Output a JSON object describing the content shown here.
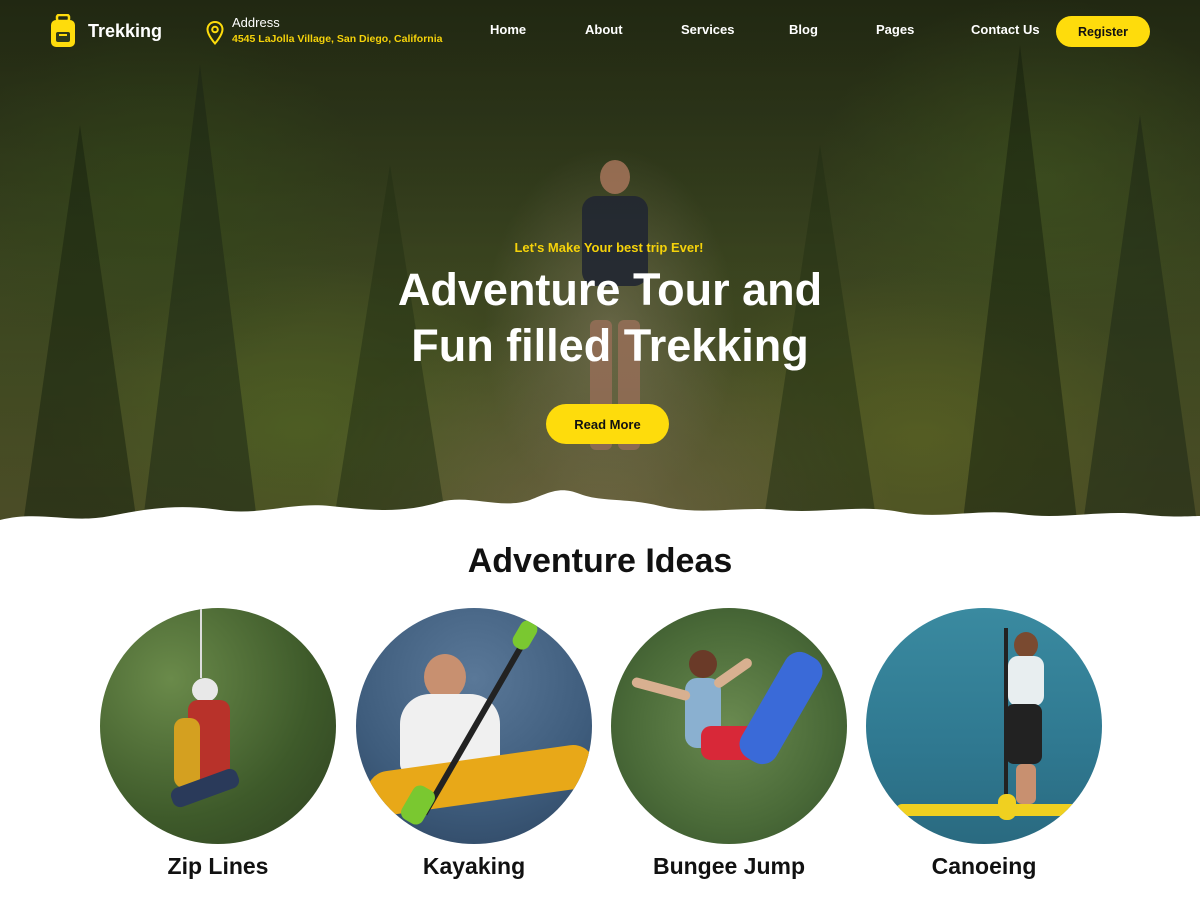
{
  "brand": {
    "name": "Trekking"
  },
  "address": {
    "label": "Address",
    "value": "4545 LaJolla Village, San Diego, California"
  },
  "nav": {
    "items": [
      {
        "label": "Home"
      },
      {
        "label": "About"
      },
      {
        "label": "Services"
      },
      {
        "label": "Blog"
      },
      {
        "label": "Pages"
      },
      {
        "label": "Contact Us"
      }
    ],
    "register_label": "Register"
  },
  "hero": {
    "tagline": "Let's Make Your best trip Ever!",
    "title_line1": "Adventure Tour and",
    "title_line2": "Fun filled Trekking",
    "cta_label": "Read More"
  },
  "ideas": {
    "title": "Adventure Ideas",
    "items": [
      {
        "label": "Zip Lines"
      },
      {
        "label": "Kayaking"
      },
      {
        "label": "Bungee Jump"
      },
      {
        "label": "Canoeing"
      }
    ]
  },
  "colors": {
    "accent": "#fedc0c",
    "text_dark": "#111111",
    "white": "#ffffff"
  },
  "icons": {
    "logo": "backpack-icon",
    "address": "map-pin-icon"
  }
}
